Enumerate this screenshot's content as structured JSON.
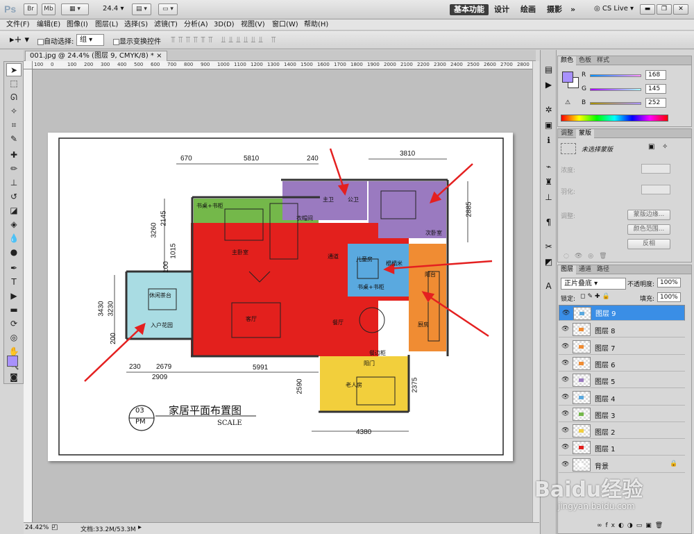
{
  "app": {
    "logo": "Ps",
    "zoom_dropdown": "24.4",
    "title_buttons": [
      "Br",
      "Mb"
    ],
    "workspaces": [
      "基本功能",
      "设计",
      "绘画",
      "摄影"
    ],
    "more": "»",
    "cslive": "CS Live"
  },
  "menu": [
    "文件(F)",
    "编辑(E)",
    "图像(I)",
    "图层(L)",
    "选择(S)",
    "滤镜(T)",
    "分析(A)",
    "3D(D)",
    "视图(V)",
    "窗口(W)",
    "帮助(H)"
  ],
  "options": {
    "auto_select_label": "自动选择:",
    "auto_select_value": "组",
    "show_transform_label": "显示变换控件"
  },
  "document": {
    "tab_title": "001.jpg @ 24.4% (图层 9, CMYK/8) *",
    "tab_close": "×",
    "ruler_top": [
      "100",
      "0",
      "100",
      "200",
      "300",
      "400",
      "500",
      "600",
      "700",
      "800",
      "900",
      "1000",
      "1100",
      "1200",
      "1300",
      "1400",
      "1500",
      "1600",
      "1700",
      "1800",
      "1900",
      "2000",
      "2100",
      "2200",
      "2300",
      "2400",
      "2500",
      "2600",
      "2700",
      "2800",
      "2900",
      "3000"
    ],
    "status_zoom": "24.42%",
    "status_doc": "文档:33.2M/53.3M"
  },
  "plan": {
    "dims_top": [
      "670",
      "5810",
      "240",
      "3810"
    ],
    "dims_left": [
      "3260",
      "2145",
      "1015",
      "100",
      "3430",
      "3230",
      "200"
    ],
    "dims_right": [
      "2885",
      "2375"
    ],
    "dims_bottom": [
      "230",
      "2679",
      "2909",
      "5991",
      "2590",
      "4380"
    ],
    "rooms": {
      "master": "主卧室",
      "wardrobe": "衣帽间",
      "bath1": "主卫",
      "bath2": "公卫",
      "second": "次卧室",
      "corridor": "通道",
      "child": "儿童房",
      "balcony": "阳台",
      "living": "客厅",
      "dining": "餐厅",
      "kitchen": "厨房",
      "tea": "休闲茶台",
      "garden": "入户花园",
      "elder": "老人房",
      "desk1": "书桌+书柜",
      "desk2": "书桌+书柜",
      "closet": "榻榻米",
      "sideboard": "餐边柜",
      "door": "阳门"
    },
    "title": "家居平面布置图",
    "badge_num": "03",
    "badge_unit": "PM",
    "scale": "SCALE"
  },
  "panels": {
    "color_tabs": [
      "颜色",
      "色板",
      "样式"
    ],
    "r_label": "R",
    "r": "168",
    "g_label": "G",
    "g": "145",
    "b_label": "B",
    "b": "252",
    "fg_color": "#a891fc",
    "adj_tabs": [
      "调整",
      "蒙版"
    ],
    "mask_title": "未选择蒙版",
    "density_label": "浓度:",
    "feather_label": "羽化:",
    "refine_label": "调整:",
    "mask_edge": "蒙版边缘...",
    "color_range": "颜色范围...",
    "invert": "反相",
    "layers_tabs": [
      "图层",
      "通道",
      "路径"
    ],
    "blend_mode": "正片叠底",
    "opacity_label": "不透明度:",
    "opacity": "100%",
    "lock_label": "锁定:",
    "fill_label": "填充:",
    "fill": "100%",
    "layers": [
      "图层 9",
      "图层 8",
      "图层 7",
      "图层 6",
      "图层 5",
      "图层 4",
      "图层 3",
      "图层 2",
      "图层 1",
      "背景"
    ],
    "watermark": "Baidu经验",
    "watermark_url": "jingyan.baidu.com"
  },
  "colors": {
    "green": "#74b84a",
    "purple": "#9a7ac0",
    "red": "#e3201d",
    "blue": "#5aa9df",
    "orange": "#f08c33",
    "cyan": "#a9dce3",
    "yellow": "#f2cf3c",
    "arrow": "#e42020",
    "selected_layer": "#3a8ee6"
  }
}
